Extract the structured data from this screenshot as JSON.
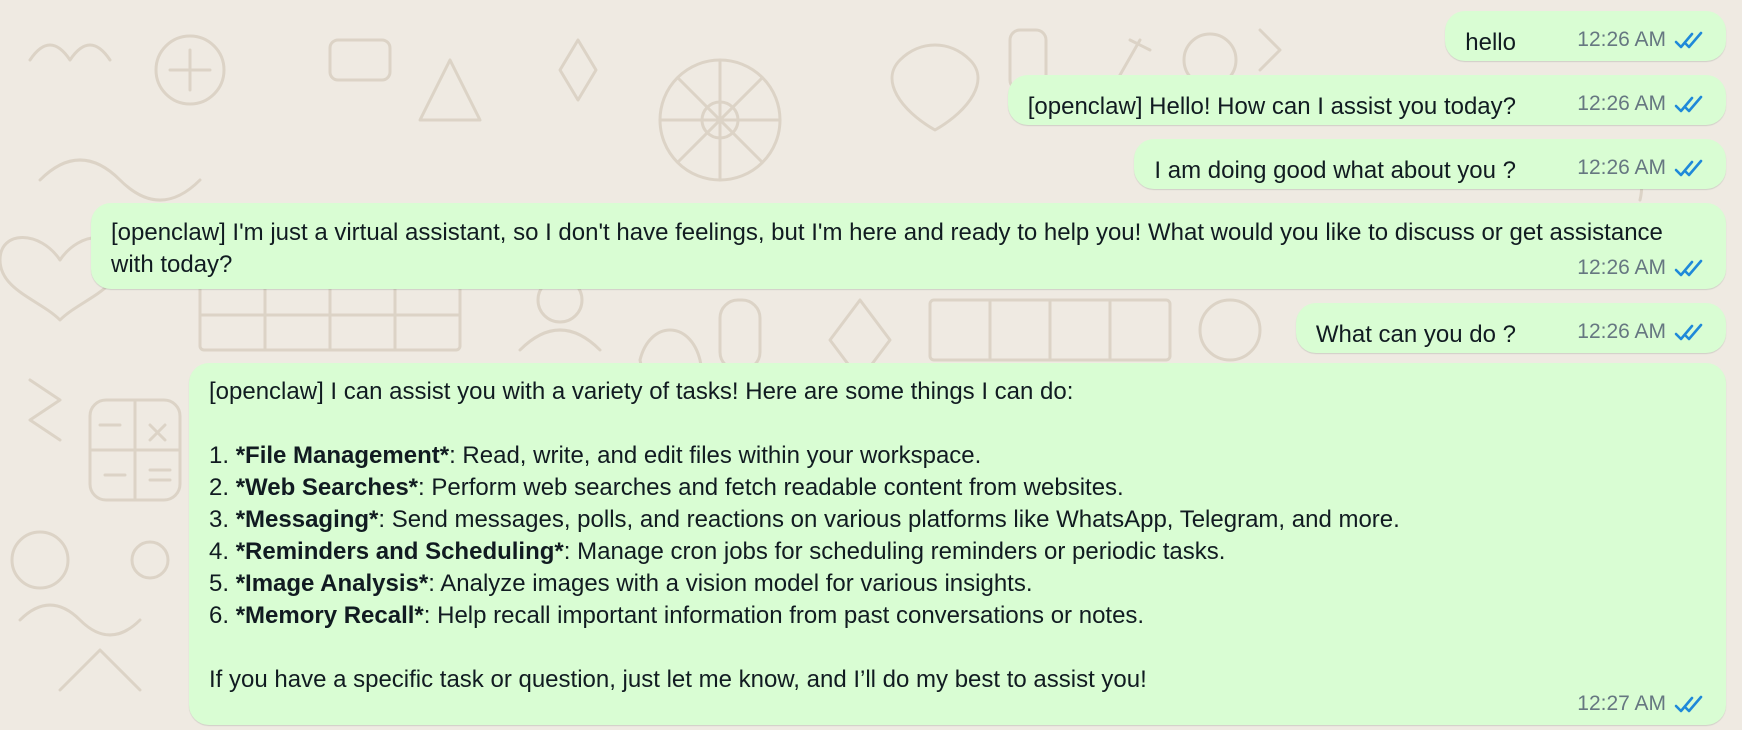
{
  "theme": {
    "wallpaper_color": "#efeae2",
    "doodle_color": "#dcd3c6",
    "outgoing_bubble_color": "#d9fdd3",
    "read_tick_color": "#1f89d9",
    "timestamp_color": "#667781"
  },
  "messages": [
    {
      "text": "hello",
      "time": "12:26 AM",
      "status_icon": "double-check-read"
    },
    {
      "text": "[openclaw] Hello! How can I assist you today?",
      "time": "12:26 AM",
      "status_icon": "double-check-read"
    },
    {
      "text": "I am doing good what about you ?",
      "time": "12:26 AM",
      "status_icon": "double-check-read"
    },
    {
      "text": "[openclaw] I'm just a virtual assistant, so I don't have feelings, but I'm here and ready to help you! What would you like to discuss or get assistance with today?",
      "time": "12:26 AM",
      "status_icon": "double-check-read"
    },
    {
      "text": "What can you do ?",
      "time": "12:26 AM",
      "status_icon": "double-check-read"
    },
    {
      "intro": "[openclaw] I can assist you with a variety of tasks! Here are some things I can do:",
      "items": [
        {
          "number": "1.",
          "title": "*File Management*",
          "desc": ": Read, write, and edit files within your workspace."
        },
        {
          "number": "2.",
          "title": "*Web Searches*",
          "desc": ": Perform web searches and fetch readable content from websites."
        },
        {
          "number": "3.",
          "title": "*Messaging*",
          "desc": ": Send messages, polls, and reactions on various platforms like WhatsApp, Telegram, and more."
        },
        {
          "number": "4.",
          "title": "*Reminders and Scheduling*",
          "desc": ": Manage cron jobs for scheduling reminders or periodic tasks."
        },
        {
          "number": "5.",
          "title": "*Image Analysis*",
          "desc": ": Analyze images with a vision model for various insights."
        },
        {
          "number": "6.",
          "title": "*Memory Recall*",
          "desc": ": Help recall important information from past conversations or notes."
        }
      ],
      "outro": "If you have a specific task or question, just let me know, and I’ll do my best to assist you!",
      "time": "12:27 AM",
      "status_icon": "double-check-read"
    }
  ]
}
